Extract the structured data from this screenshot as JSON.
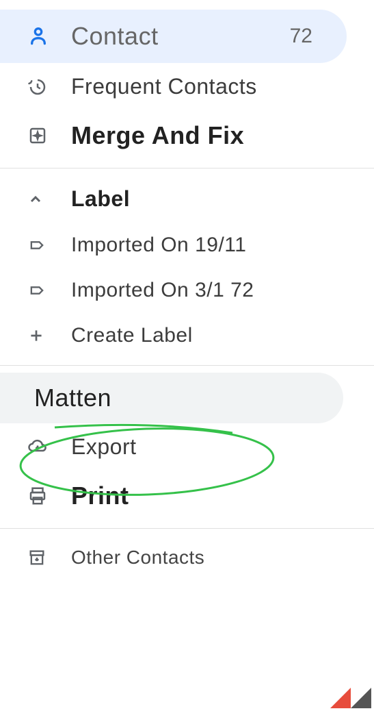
{
  "nav": {
    "contact": {
      "label": "Contact",
      "count": "72"
    },
    "frequent": {
      "label": "Frequent Contacts"
    },
    "merge": {
      "label": "Merge And Fix"
    },
    "labelHeader": "Label",
    "labels": [
      {
        "label": "Imported On 19/11"
      },
      {
        "label": "Imported On 3/1 72"
      }
    ],
    "createLabel": "Create Label",
    "matten": "Matten",
    "export": "Export",
    "print": "Print",
    "other": "Other Contacts"
  },
  "colors": {
    "highlight": "#35c14a",
    "selectedBg": "#e8f0fe",
    "activeBg": "#f1f3f4",
    "accent": "#1a73e8"
  }
}
